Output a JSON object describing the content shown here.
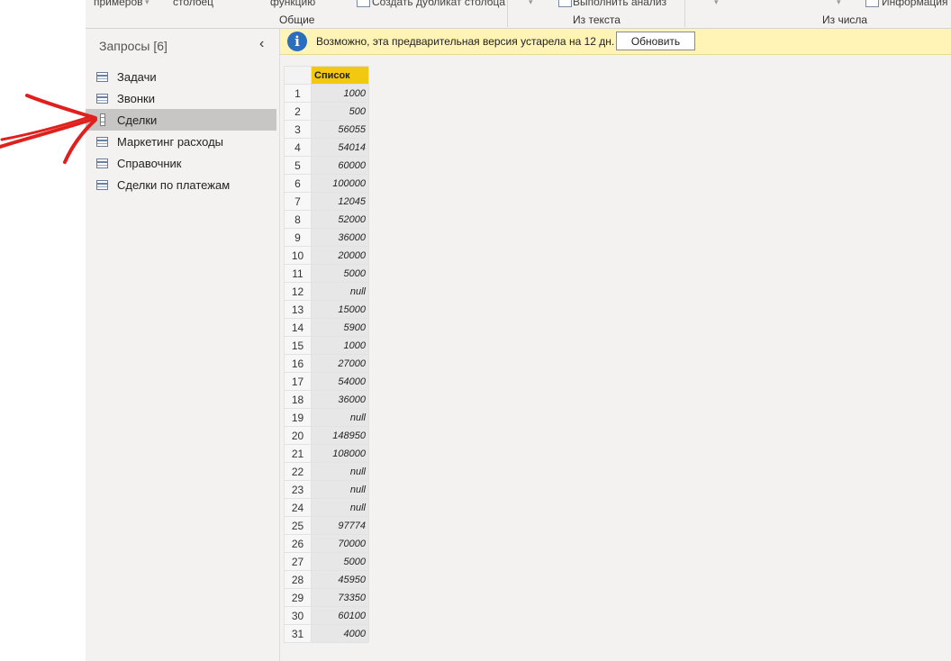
{
  "ribbon": {
    "fragments": [
      "примеров",
      "столбец",
      "функцию",
      "Создать дубликат столбца",
      "Выполнить анализ",
      "Информация"
    ],
    "groups": [
      "Общие",
      "Из текста",
      "Из числа"
    ]
  },
  "queries": {
    "title": "Запросы [6]",
    "collapse_icon": "‹",
    "items": [
      {
        "label": "Задачи",
        "icon": "table-icon"
      },
      {
        "label": "Звонки",
        "icon": "table-icon"
      },
      {
        "label": "Сделки",
        "icon": "list-icon",
        "selected": true
      },
      {
        "label": "Маркетинг расходы",
        "icon": "table-icon"
      },
      {
        "label": "Справочник",
        "icon": "table-icon"
      },
      {
        "label": "Сделки по платежам",
        "icon": "table-icon"
      }
    ]
  },
  "banner": {
    "icon": "i",
    "text": "Возможно, эта предварительная версия устарела на 12 дн.",
    "button": "Обновить"
  },
  "grid": {
    "column": "Список",
    "rows": [
      {
        "n": "1",
        "v": "1000"
      },
      {
        "n": "2",
        "v": "500"
      },
      {
        "n": "3",
        "v": "56055"
      },
      {
        "n": "4",
        "v": "54014"
      },
      {
        "n": "5",
        "v": "60000"
      },
      {
        "n": "6",
        "v": "100000"
      },
      {
        "n": "7",
        "v": "12045"
      },
      {
        "n": "8",
        "v": "52000"
      },
      {
        "n": "9",
        "v": "36000"
      },
      {
        "n": "10",
        "v": "20000"
      },
      {
        "n": "11",
        "v": "5000"
      },
      {
        "n": "12",
        "v": "null"
      },
      {
        "n": "13",
        "v": "15000"
      },
      {
        "n": "14",
        "v": "5900"
      },
      {
        "n": "15",
        "v": "1000"
      },
      {
        "n": "16",
        "v": "27000"
      },
      {
        "n": "17",
        "v": "54000"
      },
      {
        "n": "18",
        "v": "36000"
      },
      {
        "n": "19",
        "v": "null"
      },
      {
        "n": "20",
        "v": "148950"
      },
      {
        "n": "21",
        "v": "108000"
      },
      {
        "n": "22",
        "v": "null"
      },
      {
        "n": "23",
        "v": "null"
      },
      {
        "n": "24",
        "v": "null"
      },
      {
        "n": "25",
        "v": "97774"
      },
      {
        "n": "26",
        "v": "70000"
      },
      {
        "n": "27",
        "v": "5000"
      },
      {
        "n": "28",
        "v": "45950"
      },
      {
        "n": "29",
        "v": "73350"
      },
      {
        "n": "30",
        "v": "60100"
      },
      {
        "n": "31",
        "v": "4000"
      }
    ]
  },
  "colors": {
    "header": "#f2c811",
    "banner": "#fff3b5",
    "selected": "#c8c6c4",
    "arrow": "#e0201c"
  }
}
